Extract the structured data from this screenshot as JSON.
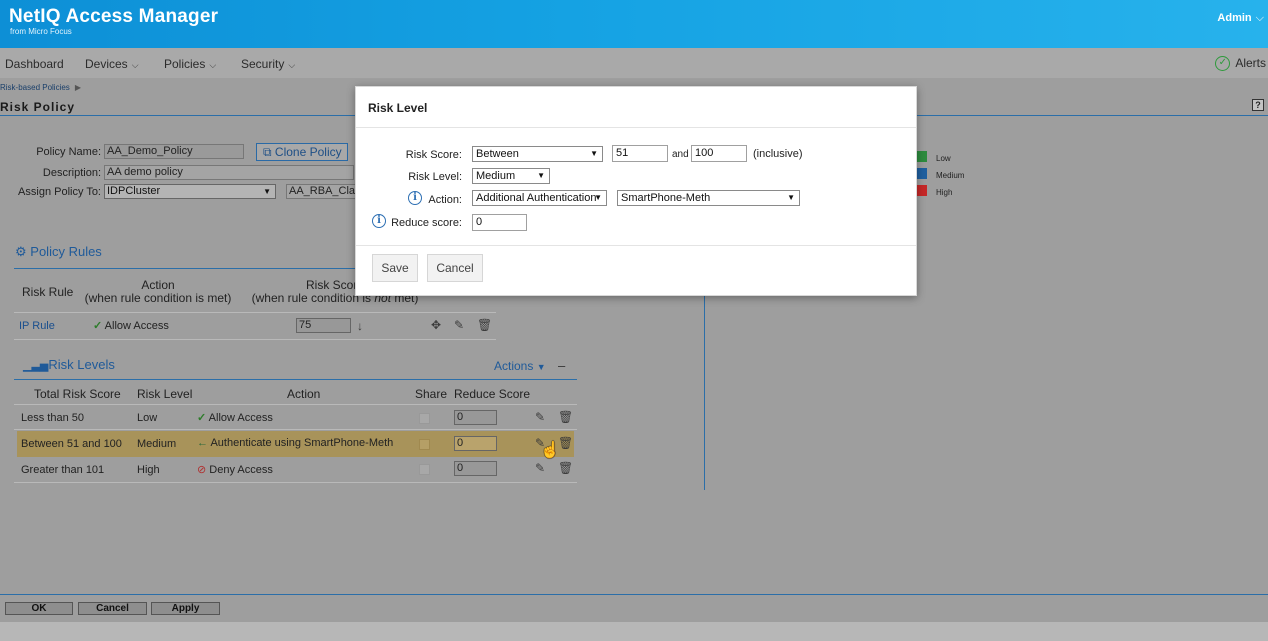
{
  "header": {
    "brand": "NetIQ Access Manager",
    "brand_sub": "from Micro Focus",
    "user": "Admin",
    "user_chevron": "⌵"
  },
  "nav": {
    "items": [
      {
        "label": "Dashboard"
      },
      {
        "label": "Devices"
      },
      {
        "label": "Policies"
      },
      {
        "label": "Security"
      }
    ],
    "chevron": "⌵",
    "alerts": "Alerts"
  },
  "breadcrumb": {
    "item": "Risk-based Policies"
  },
  "page": {
    "title": "Risk Policy",
    "help": "?"
  },
  "form": {
    "policy_name_label": "Policy Name:",
    "policy_name": "AA_Demo_Policy",
    "clone_label": "Clone Policy",
    "description_label": "Description:",
    "description": "AA demo policy",
    "assign_label": "Assign Policy To:",
    "assign_value": "IDPCluster",
    "assign_second": "AA_RBA_Cla"
  },
  "policy_rules": {
    "title": "Policy Rules",
    "headers": {
      "risk_rule": "Risk Rule",
      "action": "Action",
      "action_sub": "(when rule condition is met)",
      "risk_score": "Risk Score",
      "risk_score_sub_a": "(when rule condition is ",
      "risk_score_sub_em": "not",
      "risk_score_sub_b": " met)"
    },
    "rows": [
      {
        "rule": "IP Rule",
        "action": "Allow Access",
        "score": "75"
      }
    ]
  },
  "risk_levels": {
    "title": "Risk Levels",
    "actions_label": "Actions",
    "collapse": "–",
    "headers": {
      "total_score": "Total Risk Score",
      "level": "Risk Level",
      "action": "Action",
      "share": "Share",
      "reduce": "Reduce Score"
    },
    "rows": [
      {
        "total": "Less than 50",
        "level": "Low",
        "action": "Allow Access",
        "reduce": "0"
      },
      {
        "total": "Between 51 and 100",
        "level": "Medium",
        "action": "Authenticate using SmartPhone-Meth",
        "reduce": "0"
      },
      {
        "total": "Greater than 101",
        "level": "High",
        "action": "Deny Access",
        "reduce": "0"
      }
    ]
  },
  "legend": [
    {
      "label": "Low",
      "color": "#2e8b3e"
    },
    {
      "label": "Medium",
      "color": "#1f5f9f"
    },
    {
      "label": "High",
      "color": "#c62828"
    }
  ],
  "footer": {
    "ok": "OK",
    "cancel": "Cancel",
    "apply": "Apply"
  },
  "dialog": {
    "title": "Risk Level",
    "risk_score_label": "Risk Score:",
    "risk_score_op": "Between",
    "risk_score_from": "51",
    "and_text": "and",
    "risk_score_to": "100",
    "inclusive": "(inclusive)",
    "risk_level_label": "Risk Level:",
    "risk_level": "Medium",
    "action_label": "Action:",
    "action": "Additional Authentication",
    "method": "SmartPhone-Meth",
    "reduce_label": "Reduce score:",
    "reduce_value": "0",
    "save": "Save",
    "cancel": "Cancel"
  }
}
